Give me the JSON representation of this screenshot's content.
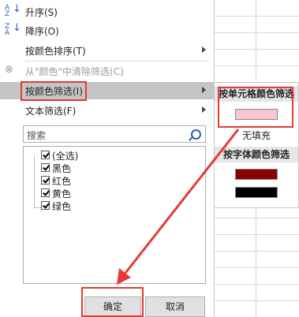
{
  "menu": {
    "sort_asc": "升序(S)",
    "sort_desc": "降序(O)",
    "sort_by_color": "按颜色排序(T)",
    "clear_filter": "从\"颜色\"中清除筛选(C)",
    "filter_by_color": "按颜色筛选(I)",
    "text_filter": "文本筛选(F)"
  },
  "search": {
    "placeholder": "搜索"
  },
  "list": {
    "items": [
      {
        "label": "(全选)",
        "checked": true
      },
      {
        "label": "黑色",
        "checked": true
      },
      {
        "label": "红色",
        "checked": true
      },
      {
        "label": "黄色",
        "checked": true
      },
      {
        "label": "绿色",
        "checked": true
      }
    ]
  },
  "buttons": {
    "ok": "确定",
    "cancel": "取消"
  },
  "submenu": {
    "cell_color_header": "按单元格颜色筛选",
    "no_fill": "无填充",
    "font_color_header": "按字体颜色筛选",
    "cell_color_swatch": "#f7c6ce",
    "font_color_swatches": [
      "#8b0000",
      "#000000"
    ]
  },
  "colors": {
    "highlight_red": "#e53935",
    "accent_blue": "#2f5fb3"
  }
}
